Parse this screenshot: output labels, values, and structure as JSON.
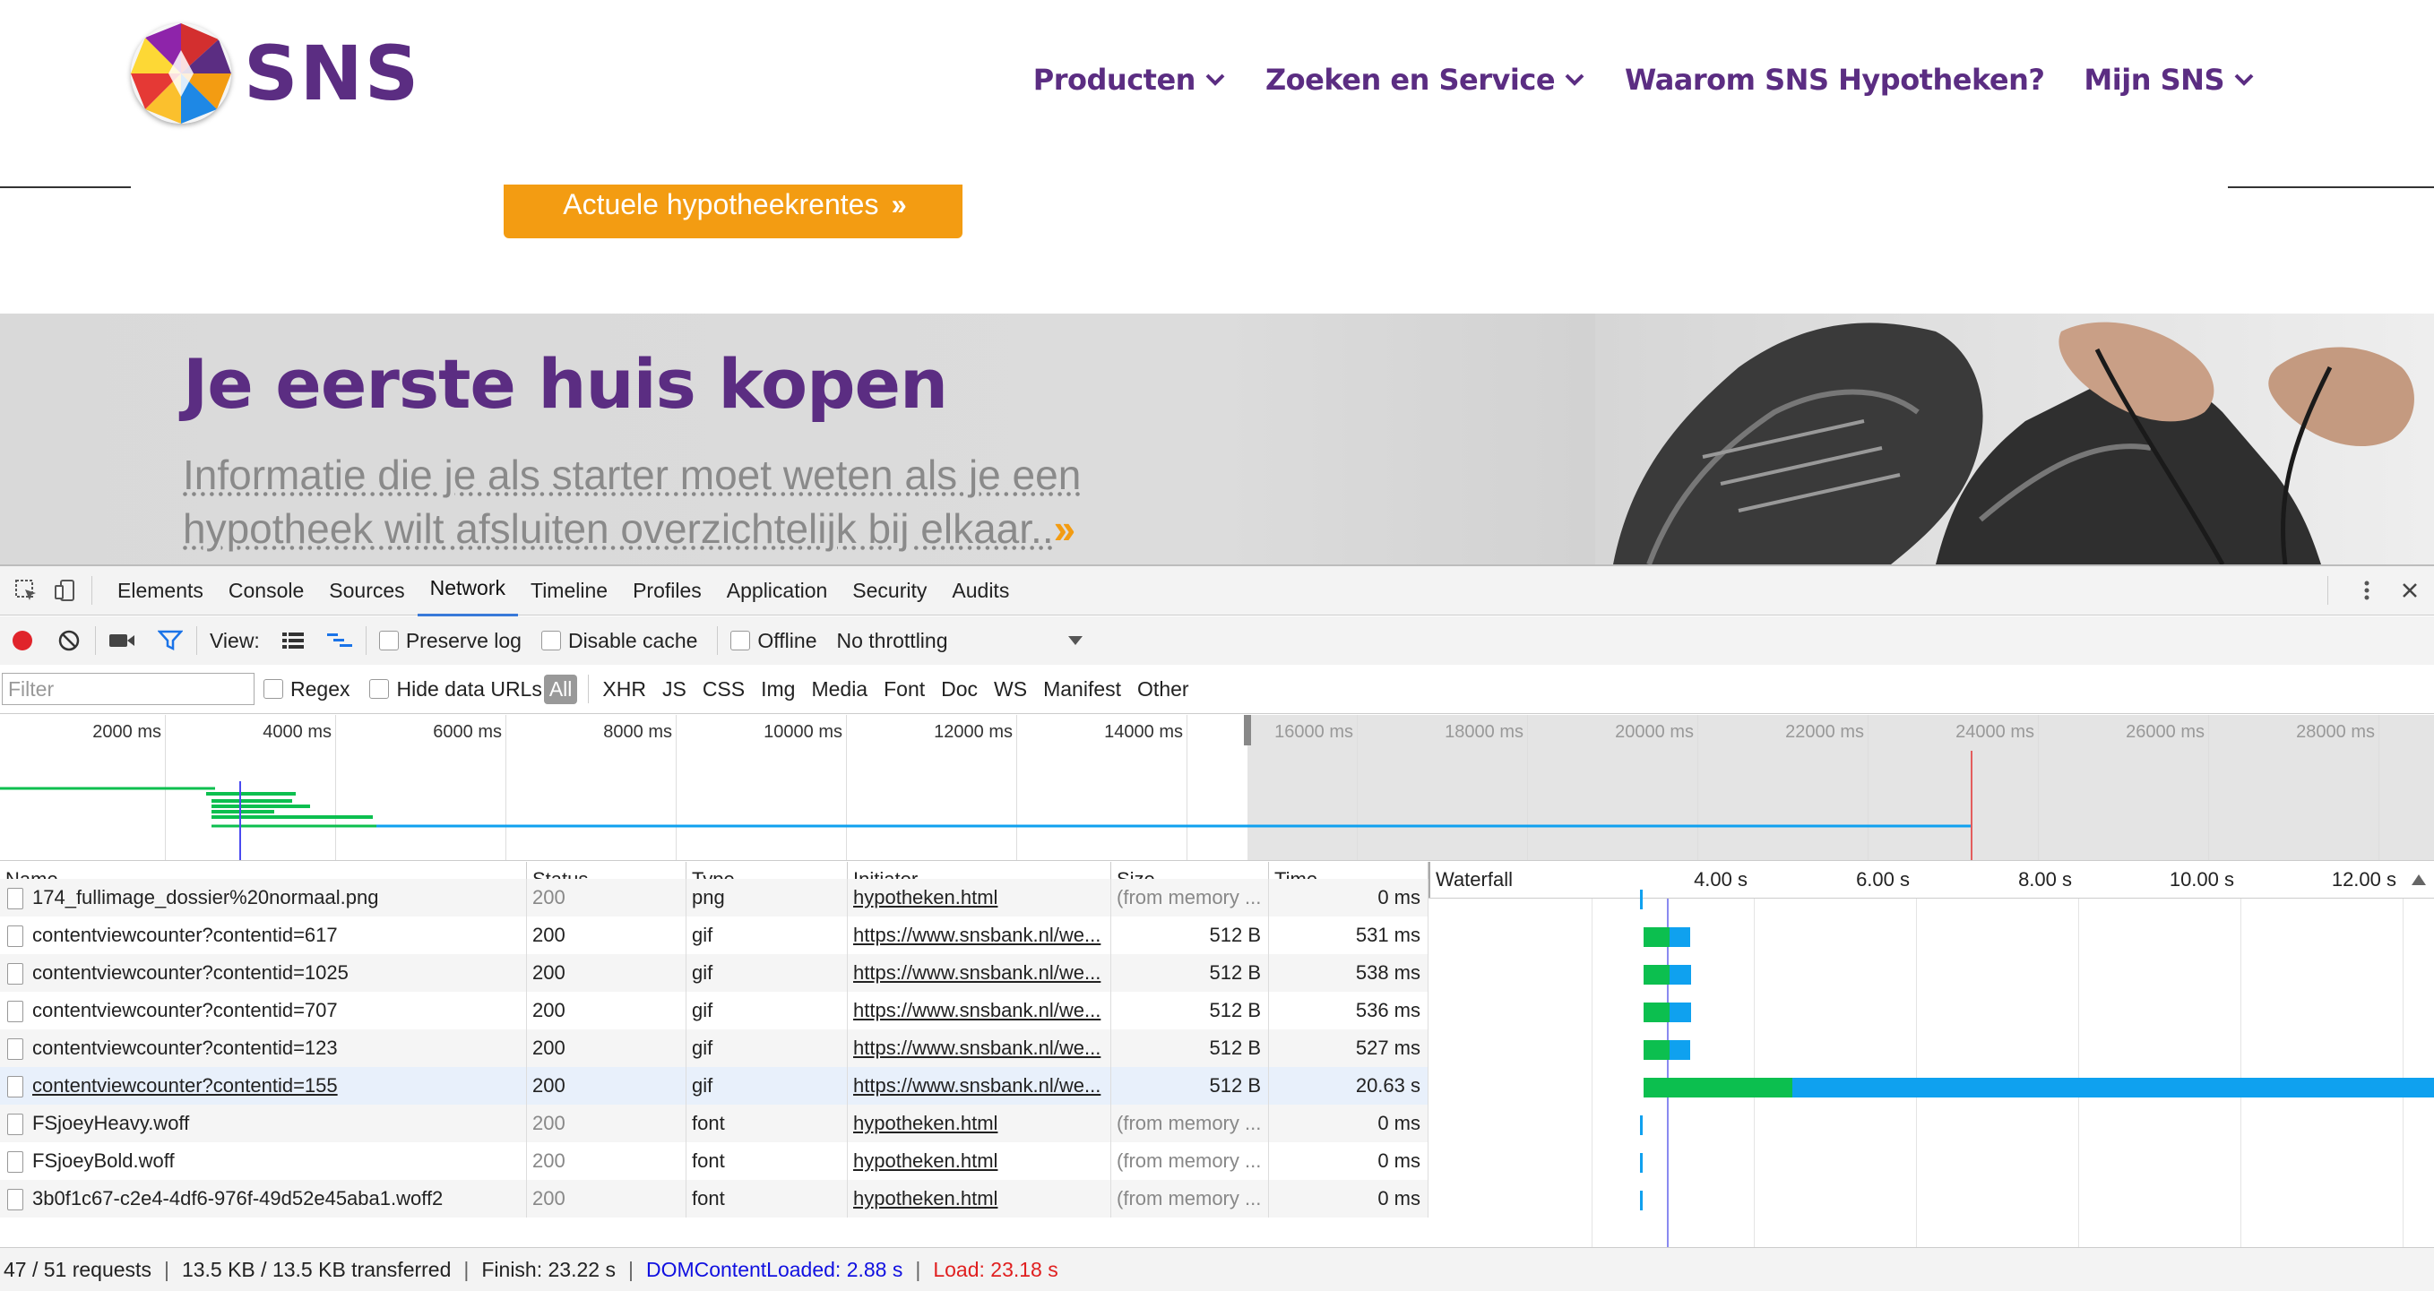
{
  "site": {
    "logo_text": "SNS",
    "nav": [
      {
        "label": "Producten",
        "has_menu": true
      },
      {
        "label": "Zoeken en Service",
        "has_menu": true
      },
      {
        "label": "Waarom SNS Hypotheken?",
        "has_menu": false
      },
      {
        "label": "Mijn SNS",
        "has_menu": true
      }
    ],
    "cta_label": "Actuele hypotheekrentes",
    "hero": {
      "title": "Je eerste huis kopen",
      "subtitle_line1": "Informatie die je als starter moet weten als je een",
      "subtitle_line2": "hypotheek wilt afsluiten overzichtelijk bij elkaar.."
    },
    "colors": {
      "brand": "#5b2d82",
      "accent": "#f39c12"
    }
  },
  "devtools": {
    "tabs": [
      "Elements",
      "Console",
      "Sources",
      "Network",
      "Timeline",
      "Profiles",
      "Application",
      "Security",
      "Audits"
    ],
    "active_tab": "Network",
    "toolbar": {
      "view_label": "View:",
      "preserve_log": "Preserve log",
      "disable_cache": "Disable cache",
      "offline": "Offline",
      "throttling": "No throttling"
    },
    "filterbar": {
      "filter_placeholder": "Filter",
      "regex": "Regex",
      "hide_data_urls": "Hide data URLs",
      "types": [
        "All",
        "XHR",
        "JS",
        "CSS",
        "Img",
        "Media",
        "Font",
        "Doc",
        "WS",
        "Manifest",
        "Other"
      ],
      "active_type": "All"
    },
    "overview_ticks": [
      "2000 ms",
      "4000 ms",
      "6000 ms",
      "8000 ms",
      "10000 ms",
      "12000 ms",
      "14000 ms",
      "16000 ms",
      "18000 ms",
      "20000 ms",
      "22000 ms",
      "24000 ms",
      "26000 ms",
      "28000 ms"
    ],
    "columns": {
      "name": "Name",
      "status": "Status",
      "type": "Type",
      "initiator": "Initiator",
      "size": "Size",
      "time": "Time",
      "waterfall": "Waterfall"
    },
    "waterfall_ticks": [
      "4.00 s",
      "6.00 s",
      "8.00 s",
      "10.00 s",
      "12.00 s"
    ],
    "rows": [
      {
        "name": "174_fullimage_dossier%20normaal.png",
        "status": "200",
        "type": "png",
        "initiator": "hypotheken.html",
        "size": "(from memory ...",
        "time": "0 ms",
        "selected": false
      },
      {
        "name": "contentviewcounter?contentid=617",
        "status": "200",
        "type": "gif",
        "initiator": "https://www.snsbank.nl/we...",
        "size": "512 B",
        "time": "531 ms",
        "selected": false
      },
      {
        "name": "contentviewcounter?contentid=1025",
        "status": "200",
        "type": "gif",
        "initiator": "https://www.snsbank.nl/we...",
        "size": "512 B",
        "time": "538 ms",
        "selected": false
      },
      {
        "name": "contentviewcounter?contentid=707",
        "status": "200",
        "type": "gif",
        "initiator": "https://www.snsbank.nl/we...",
        "size": "512 B",
        "time": "536 ms",
        "selected": false
      },
      {
        "name": "contentviewcounter?contentid=123",
        "status": "200",
        "type": "gif",
        "initiator": "https://www.snsbank.nl/we...",
        "size": "512 B",
        "time": "527 ms",
        "selected": false
      },
      {
        "name": "contentviewcounter?contentid=155",
        "status": "200",
        "type": "gif",
        "initiator": "https://www.snsbank.nl/we...",
        "size": "512 B",
        "time": "20.63 s",
        "selected": true
      },
      {
        "name": "FSjoeyHeavy.woff",
        "status": "200",
        "type": "font",
        "initiator": "hypotheken.html",
        "size": "(from memory ...",
        "time": "0 ms",
        "selected": false
      },
      {
        "name": "FSjoeyBold.woff",
        "status": "200",
        "type": "font",
        "initiator": "hypotheken.html",
        "size": "(from memory ...",
        "time": "0 ms",
        "selected": false
      },
      {
        "name": "3b0f1c67-c2e4-4df6-976f-49d52e45aba1.woff2",
        "status": "200",
        "type": "font",
        "initiator": "hypotheken.html",
        "size": "(from memory ...",
        "time": "0 ms",
        "selected": false
      }
    ],
    "status": {
      "requests": "47 / 51 requests",
      "transferred": "13.5 KB / 13.5 KB transferred",
      "finish": "Finish: 23.22 s",
      "dom_content_loaded": "DOMContentLoaded: 2.88 s",
      "load": "Load: 23.18 s"
    },
    "colors": {
      "waiting": "#0cbf4f",
      "download": "#0fa1ef",
      "dcl": "#1010e0",
      "load": "#e02020",
      "active_tab": "#3879d9"
    }
  }
}
